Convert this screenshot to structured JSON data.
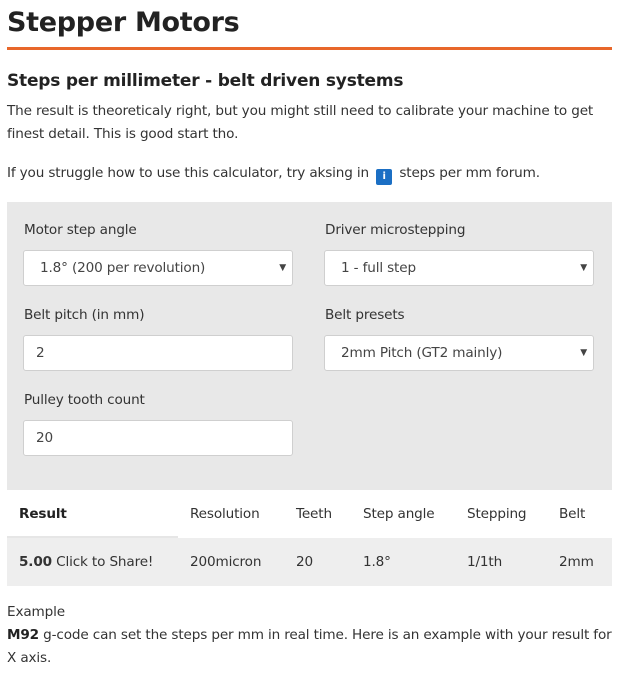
{
  "page": {
    "title": "Stepper Motors",
    "subtitle": "Steps per millimeter - belt driven systems",
    "intro_line1": "The result is theoreticaly right, but you might still need to calibrate your machine to get",
    "intro_line2": "finest detail. This is good start tho.",
    "help_before": "If you struggle how to use this calculator, try aksing in",
    "help_after": "steps per mm forum.",
    "help_icon_glyph": "i"
  },
  "form": {
    "step_angle_label": "Motor step angle",
    "step_angle_value": "1.8° (200 per revolution)",
    "microstepping_label": "Driver microstepping",
    "microstepping_value": "1 - full step",
    "belt_pitch_label": "Belt pitch (in mm)",
    "belt_pitch_value": "2",
    "belt_presets_label": "Belt presets",
    "belt_presets_value": "2mm Pitch (GT2 mainly)",
    "pulley_label": "Pulley tooth count",
    "pulley_value": "20",
    "caret_glyph": "▼"
  },
  "results": {
    "headers": [
      "Result",
      "Resolution",
      "Teeth",
      "Step angle",
      "Stepping",
      "Belt"
    ],
    "row": {
      "result_value": "5.00",
      "share_label": "Click to Share!",
      "resolution": "200micron",
      "teeth": "20",
      "step_angle": "1.8°",
      "stepping": "1/1th",
      "belt": "2mm"
    }
  },
  "example": {
    "heading": "Example",
    "code": "M92",
    "text_line1": "g-code can set the steps per mm in real time. Here is an example with your result for",
    "text_line2": "X axis."
  },
  "colors": {
    "accent": "#e8672a",
    "panel_bg": "#e8e8e8",
    "info_icon_bg": "#1b6fc4"
  }
}
